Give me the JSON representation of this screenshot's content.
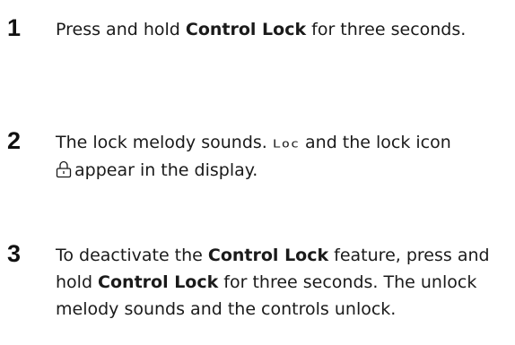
{
  "steps": [
    {
      "number": "1",
      "text_before": "Press and hold ",
      "bold_1": "Control Lock",
      "text_after": " for three seconds."
    },
    {
      "number": "2",
      "text_before": "The lock melody sounds. ",
      "display_code": "Loc",
      "text_middle": " and the lock icon ",
      "icon": "lock-icon",
      "text_after": "appear in the display."
    },
    {
      "number": "3",
      "text_before": "To deactivate the ",
      "bold_1": "Control Lock",
      "text_middle": " feature, press and hold ",
      "bold_2": "Control Lock",
      "text_after": " for three seconds. The unlock melody sounds and the controls unlock."
    }
  ]
}
